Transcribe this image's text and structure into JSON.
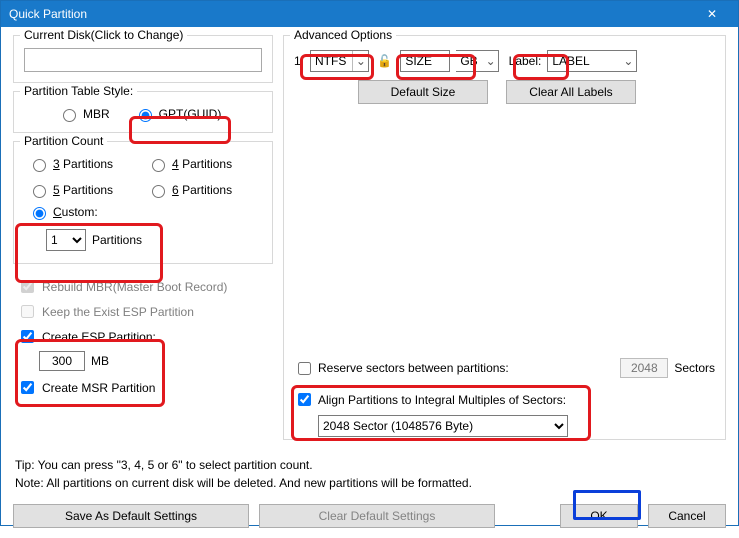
{
  "titlebar": {
    "title": "Quick Partition",
    "close": "✕"
  },
  "disk": {
    "legend": "Current Disk(Click to Change)",
    "value": ""
  },
  "table_style": {
    "legend": "Partition Table Style:",
    "mbr": "MBR",
    "gpt": "GPT(GUID)",
    "selected": "gpt"
  },
  "count": {
    "legend": "Partition Count",
    "p3": "3 Partitions",
    "p4": "4 Partitions",
    "p5": "5 Partitions",
    "p6": "6 Partitions",
    "custom_label": "Custom:",
    "custom_value": "1",
    "custom_unit": "Partitions",
    "selected": "custom"
  },
  "checks": {
    "rebuild_mbr": "Rebuild MBR(Master Boot Record)",
    "keep_esp": "Keep the Exist ESP Partition",
    "create_esp": "Create ESP Partition:",
    "esp_size": "300",
    "esp_unit": "MB",
    "create_msr": "Create MSR Partition"
  },
  "advanced": {
    "legend": "Advanced Options",
    "row_prefix": "1:",
    "fs": "NTFS",
    "size": "SIZE",
    "size_unit": "GB",
    "label_prefix": "Label:",
    "label_value": "LABEL",
    "default_size_btn": "Default Size",
    "clear_labels_btn": "Clear All Labels",
    "reserve_label": "Reserve sectors between partitions:",
    "reserve_value": "2048",
    "reserve_unit": "Sectors",
    "align_label": "Align Partitions to Integral Multiples of Sectors:",
    "align_value": "2048 Sector (1048576 Byte)"
  },
  "notes": {
    "tip": "Tip:  You can press \"3, 4, 5 or 6\" to select partition count.",
    "note": "Note: All partitions on current disk will be deleted. And new partitions will be formatted."
  },
  "buttons": {
    "save_default": "Save As Default Settings",
    "clear_default": "Clear Default Settings",
    "ok": "OK",
    "cancel": "Cancel"
  }
}
